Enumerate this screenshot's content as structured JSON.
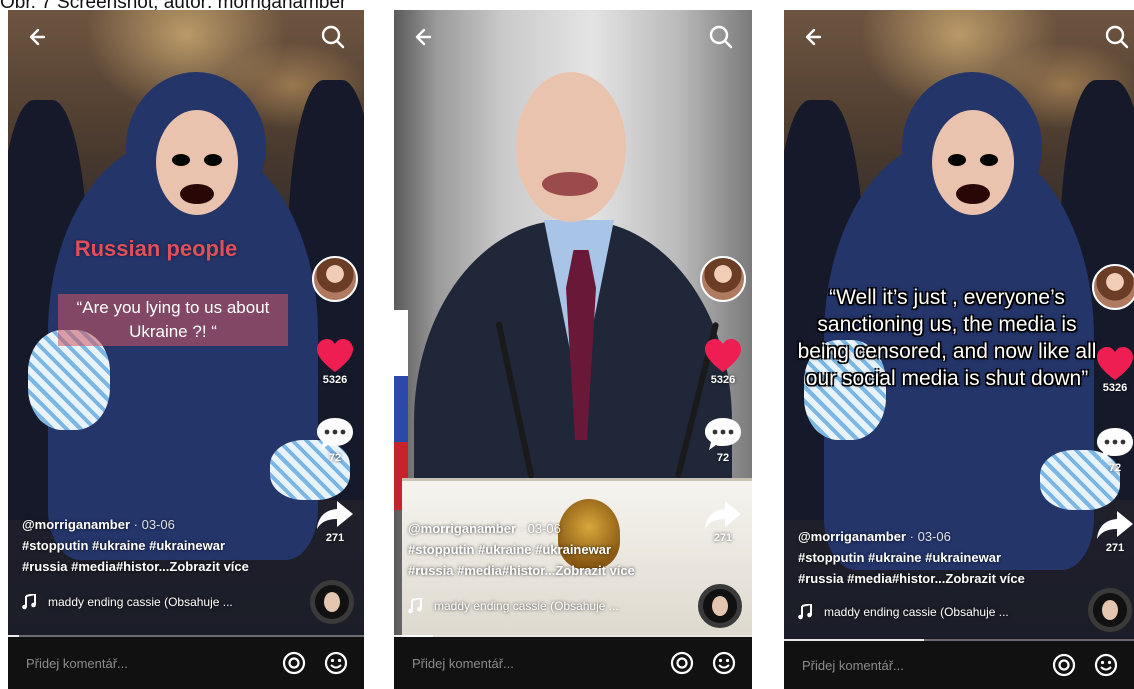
{
  "caption": "Obr. 7 Screenshot, autor: morriganamber",
  "colors": {
    "like_red": "#ee1d52",
    "comment_bar": "#111111",
    "title_red": "#e04f5a"
  },
  "icons": [
    "back-arrow-icon",
    "search-icon",
    "heart-icon",
    "comment-icon",
    "share-icon",
    "music-note-icon",
    "at-icon",
    "emoji-icon"
  ],
  "panels": [
    {
      "overlay_title": "Russian people",
      "overlay_quote": "“Are you lying to us about Ukraine ?! “",
      "likes": "5326",
      "comments": "72",
      "shares": "271",
      "username": "@morriganamber",
      "date": " · 03-06",
      "hashtags_line1": "#stopputin #ukraine #ukrainewar",
      "hashtags_line2": "#russia #media#histor...",
      "see_more": "Zobrazit více",
      "music": "maddy ending cassie (Obsahuje ...",
      "comment_placeholder": "Přidej komentář...",
      "progress": 0.03
    },
    {
      "likes": "5326",
      "comments": "72",
      "shares": "271",
      "username": "@morriganamber",
      "date": " · 03-06",
      "hashtags_line1": "#stopputin #ukraine #ukrainewar",
      "hashtags_line2": "#russia #media#histor...",
      "see_more": "Zobrazit více",
      "music": "maddy ending cassie (Obsahuje ...",
      "comment_placeholder": "Přidej komentář...",
      "progress": 0.11
    },
    {
      "overlay_quote": "“Well it’s just , everyone’s sanctioning us, the media is being censored, and now like all our social media is shut down”",
      "likes": "5326",
      "comments": "72",
      "shares": "271",
      "username": "@morriganamber",
      "date": " · 03-06",
      "hashtags_line1": "#stopputin #ukraine #ukrainewar",
      "hashtags_line2": "#russia #media#histor...",
      "see_more": "Zobrazit více",
      "music": "maddy ending cassie (Obsahuje ...",
      "comment_placeholder": "Přidej komentář...",
      "progress": 0.4
    }
  ]
}
